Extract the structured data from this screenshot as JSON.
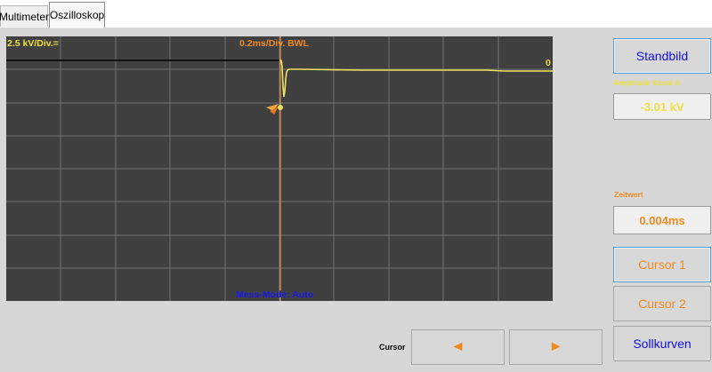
{
  "tabs": [
    {
      "label": "Multimeter"
    },
    {
      "label": "Oszilloskop"
    }
  ],
  "scope": {
    "volts_per_div": "2.5 kV/Div.=",
    "time_per_div": "0.2ms/Div. BWL",
    "zero_marker": "0",
    "mess_mode": "Mess-Mode: Auto",
    "trace_color": "#f0e060",
    "grid_color": "#707070",
    "cursor_color": "#f4a640"
  },
  "right_panel": {
    "standbild_label": "Standbild",
    "amplitude_title": "Amplitude Kanal A",
    "amplitude_value": "-3.01 kV",
    "zeitwert_title": "Zeitwert",
    "zeitwert_value": "0.004ms",
    "cursor1_label": "Cursor 1",
    "cursor2_label": "Cursor 2",
    "sollkurven_label": "Sollkurven"
  },
  "bottom": {
    "cursor_label": "Cursor",
    "left_arrow": "◄",
    "right_arrow": "►"
  },
  "colors": {
    "accent_blue": "#1010e0",
    "accent_orange": "#f08a20",
    "accent_yellow": "#f0e040"
  }
}
